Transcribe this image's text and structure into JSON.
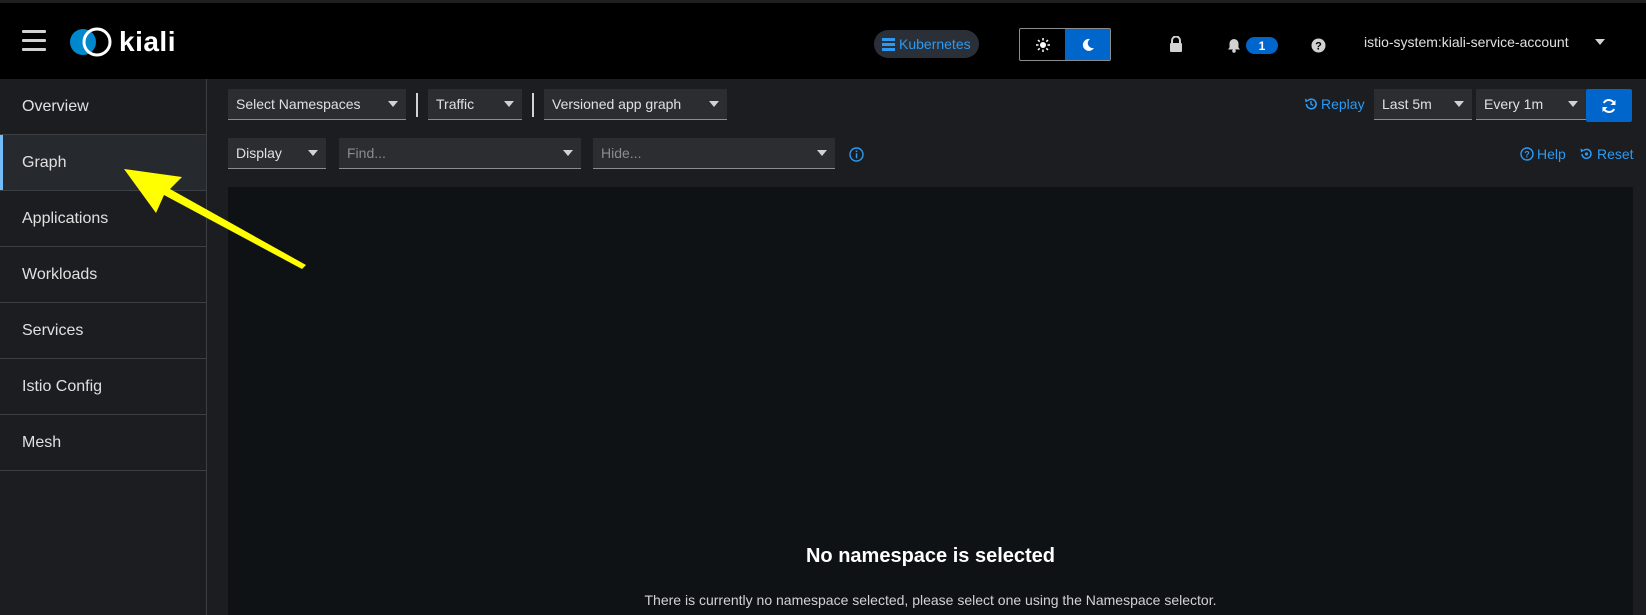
{
  "masthead": {
    "logo_text": "kiali",
    "cluster_badge": "Kubernetes",
    "notification_count": "1",
    "user": "istio-system:kiali-service-account",
    "theme_light_icon": "sun-icon",
    "theme_dark_icon": "moon-icon",
    "colors": {
      "accent": "#0066cc",
      "link": "#2b9af3"
    }
  },
  "sidebar": {
    "items": [
      {
        "label": "Overview"
      },
      {
        "label": "Graph",
        "active": true
      },
      {
        "label": "Applications"
      },
      {
        "label": "Workloads"
      },
      {
        "label": "Services"
      },
      {
        "label": "Istio Config"
      },
      {
        "label": "Mesh"
      }
    ]
  },
  "toolbar": {
    "namespaces": "Select Namespaces",
    "traffic": "Traffic",
    "graph_type": "Versioned app graph",
    "replay": "Replay",
    "duration": "Last 5m",
    "refresh_interval": "Every 1m",
    "display": "Display",
    "find_placeholder": "Find...",
    "hide_placeholder": "Hide...",
    "help": "Help",
    "reset": "Reset"
  },
  "graph": {
    "empty_title": "No namespace is selected",
    "empty_body": "There is currently no namespace selected, please select one using the Namespace selector."
  },
  "annotation": {
    "arrow_color": "#ffff00"
  }
}
